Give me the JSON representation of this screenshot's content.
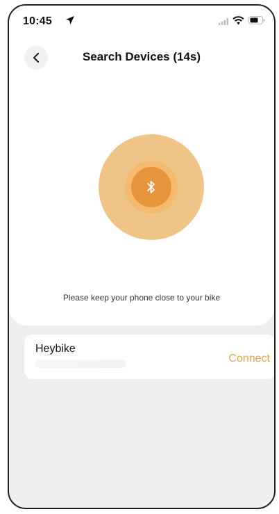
{
  "status_bar": {
    "time": "10:45",
    "icons": [
      "location-arrow-icon",
      "signal-icon",
      "wifi-icon",
      "battery-icon"
    ]
  },
  "header": {
    "back_icon": "chevron-left-icon",
    "title": "Search Devices (14s)"
  },
  "scanner": {
    "icon": "bluetooth-icon",
    "hint": "Please keep your phone close to your bike"
  },
  "devices": [
    {
      "name": "Heybike",
      "action_label": "Connect"
    }
  ],
  "colors": {
    "accent": "#e7a447",
    "outer_ring": "#f0c487",
    "inner_core": "#e6953b",
    "background": "#efeff1"
  }
}
